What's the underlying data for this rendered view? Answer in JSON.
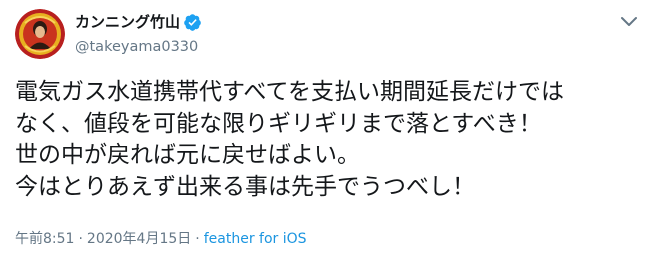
{
  "user": {
    "display_name": "カンニング竹山",
    "handle": "@takeyama0330",
    "verified": true,
    "avatar_icon": "profile-avatar-icon"
  },
  "tweet": {
    "lines": [
      "電気ガス水道携帯代すべてを支払い期間延長だけでは",
      "なく、値段を可能な限りギリギリまで落とすべき！",
      "世の中が戻れば元に戻せばよい。",
      "今はとりあえず出来る事は先手でうつべし！"
    ]
  },
  "meta": {
    "time": "午前8:51",
    "separator": "·",
    "date": "2020年4月15日",
    "source": "feather for iOS"
  },
  "colors": {
    "verified_blue": "#1da1f2",
    "source_link": "#1b95e0",
    "secondary_text": "#657786",
    "primary_text": "#14171a"
  }
}
